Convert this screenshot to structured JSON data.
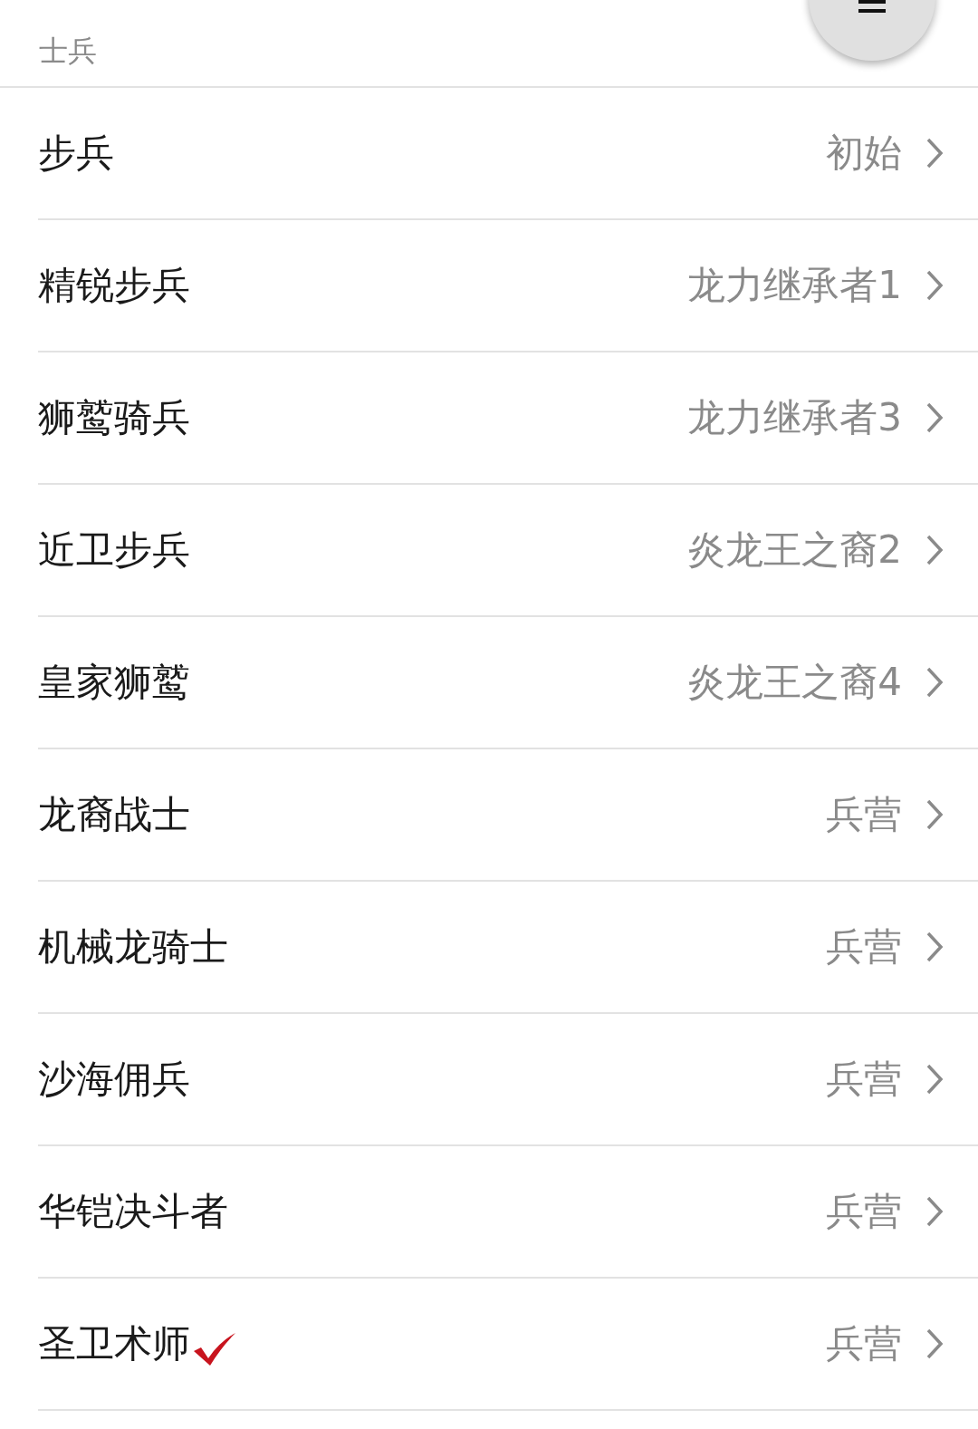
{
  "section_title": "士兵",
  "items": [
    {
      "name": "步兵",
      "source": "初始",
      "checked": false
    },
    {
      "name": "精锐步兵",
      "source": "龙力继承者1",
      "checked": false
    },
    {
      "name": "狮鹫骑兵",
      "source": "龙力继承者3",
      "checked": false
    },
    {
      "name": "近卫步兵",
      "source": "炎龙王之裔2",
      "checked": false
    },
    {
      "name": "皇家狮鹫",
      "source": "炎龙王之裔4",
      "checked": false
    },
    {
      "name": "龙裔战士",
      "source": "兵营",
      "checked": false
    },
    {
      "name": "机械龙骑士",
      "source": "兵营",
      "checked": false
    },
    {
      "name": "沙海佣兵",
      "source": "兵营",
      "checked": false
    },
    {
      "name": "华铠决斗者",
      "source": "兵营",
      "checked": false
    },
    {
      "name": "圣卫术师",
      "source": "兵营",
      "checked": true
    }
  ]
}
